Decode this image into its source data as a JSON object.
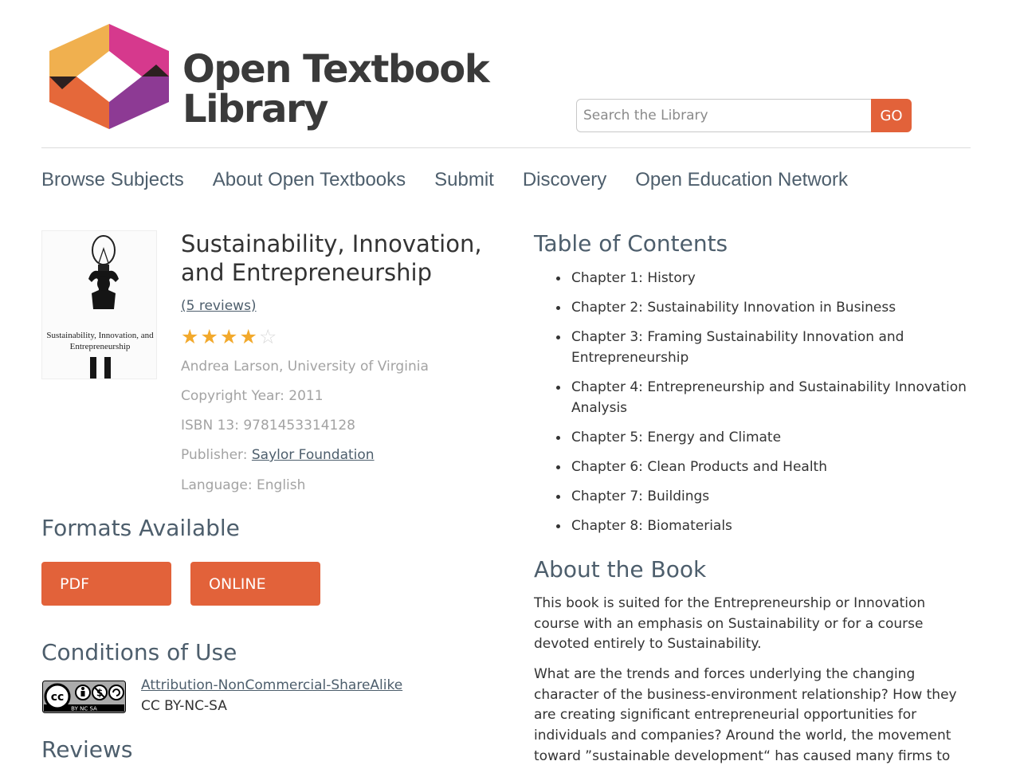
{
  "header": {
    "logo_line1": "Open Textbook",
    "logo_line2": "Library",
    "search_placeholder": "Search the Library",
    "search_button": "GO"
  },
  "nav": {
    "items": [
      "Browse Subjects",
      "About Open Textbooks",
      "Submit",
      "Discovery",
      "Open Education Network"
    ]
  },
  "book": {
    "cover_caption": "Sustainability, Innovation, and Entrepreneurship",
    "title": "Sustainability, Innovation, and Entrepreneurship",
    "reviews_link": "(5 reviews)",
    "rating": 4,
    "rating_max": 5,
    "author": "Andrea Larson, University of Virginia",
    "copyright": "Copyright Year: 2011",
    "isbn": "ISBN 13: 9781453314128",
    "publisher_label": "Publisher: ",
    "publisher_name": "Saylor Foundation",
    "language": "Language: English"
  },
  "formats": {
    "heading": "Formats Available",
    "buttons": [
      "PDF",
      "ONLINE"
    ]
  },
  "conditions": {
    "heading": "Conditions of Use",
    "badge_text": "BY NC SA",
    "license_name": "Attribution-NonCommercial-ShareAlike",
    "license_code": "CC BY-NC-SA"
  },
  "reviews": {
    "heading": "Reviews"
  },
  "toc": {
    "heading": "Table of Contents",
    "chapters": [
      "Chapter 1: History",
      "Chapter 2: Sustainability Innovation in Business",
      "Chapter 3: Framing Sustainability Innovation and Entrepreneurship",
      "Chapter 4: Entrepreneurship and Sustainability Innovation Analysis",
      "Chapter 5: Energy and Climate",
      "Chapter 6: Clean Products and Health",
      "Chapter 7: Buildings",
      "Chapter 8: Biomaterials"
    ]
  },
  "about": {
    "heading": "About the Book",
    "paragraph1": "This book is suited for the Entrepreneurship or Innovation course with an emphasis on Sustainability or for a course devoted entirely to Sustainability.",
    "paragraph2": "What are the trends and forces underlying the changing character of the business-environment relationship? How they are creating significant entrepreneurial opportunities for individuals and companies? Around the world, the movement toward ”sustainable development“ has caused many firms to"
  },
  "colors": {
    "accent": "#e2623a",
    "nav_text": "#4d5e6c",
    "meta_text": "#a3a3a3",
    "star": "#f2a92c"
  }
}
